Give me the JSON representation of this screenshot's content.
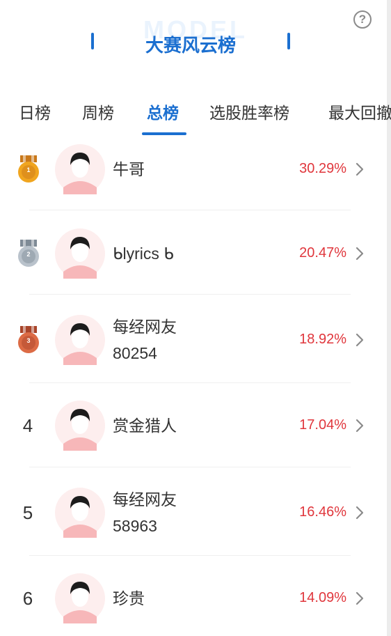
{
  "header": {
    "title": "大赛风云榜",
    "watermark": "MODEL",
    "help_icon": "question-circle-icon"
  },
  "tabs": [
    {
      "label": "日榜",
      "active": false
    },
    {
      "label": "周榜",
      "active": false
    },
    {
      "label": "总榜",
      "active": true
    },
    {
      "label": "选股胜率榜",
      "active": false
    },
    {
      "label": "最大回撤",
      "active": false
    }
  ],
  "colors": {
    "accent": "#1b6fd0",
    "gain": "#e0363c",
    "gold": "#e8a020",
    "silver": "#a9b3bd",
    "bronze": "#d0633f"
  },
  "leaderboard": [
    {
      "rank": "1",
      "medal": "gold-medal-icon",
      "name_line1": "牛哥",
      "name_line2": "",
      "return": "30.29%"
    },
    {
      "rank": "2",
      "medal": "silver-medal-icon",
      "name_line1": "ᑲlyrics ᑲ",
      "name_line2": "",
      "return": "20.47%"
    },
    {
      "rank": "3",
      "medal": "bronze-medal-icon",
      "name_line1": "每经网友",
      "name_line2": "80254",
      "return": "18.92%"
    },
    {
      "rank": "4",
      "medal": "",
      "name_line1": "赏金猎人",
      "name_line2": "",
      "return": "17.04%"
    },
    {
      "rank": "5",
      "medal": "",
      "name_line1": "每经网友",
      "name_line2": "58963",
      "return": "16.46%"
    },
    {
      "rank": "6",
      "medal": "",
      "name_line1": "珍贵",
      "name_line2": "",
      "return": "14.09%"
    }
  ]
}
